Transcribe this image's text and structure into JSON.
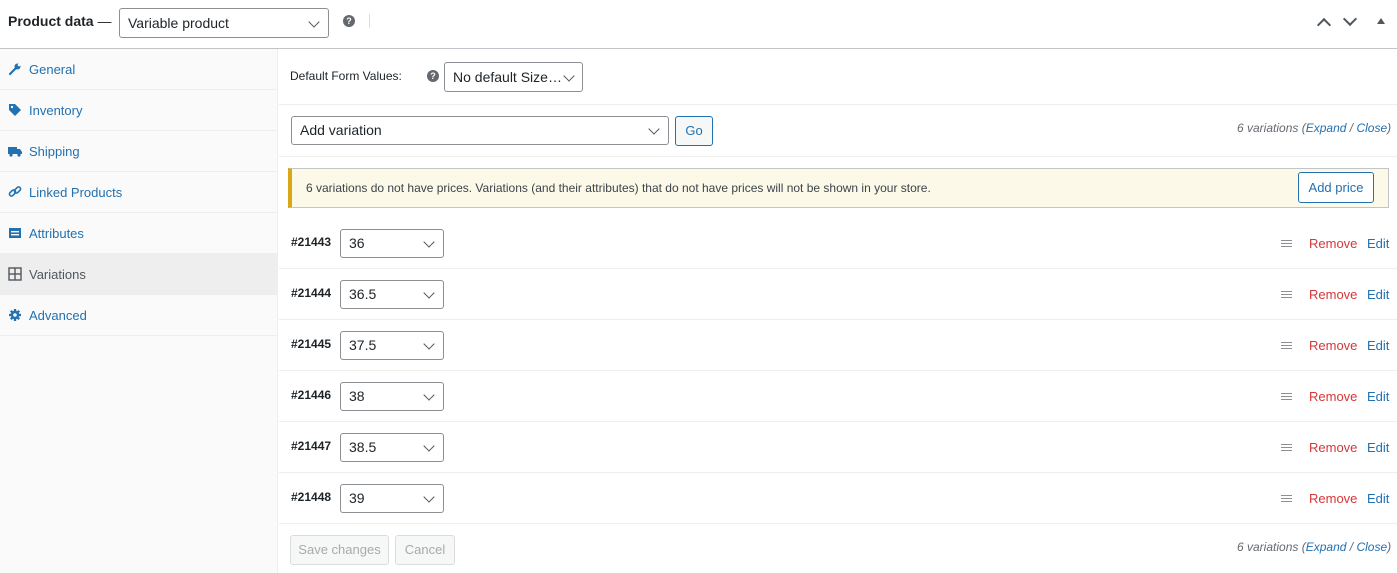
{
  "header": {
    "title": "Product data",
    "dash": "—",
    "product_type": "Variable product"
  },
  "sidebar": {
    "items": [
      {
        "label": "General",
        "icon": "wrench-icon"
      },
      {
        "label": "Inventory",
        "icon": "tag-icon"
      },
      {
        "label": "Shipping",
        "icon": "truck-icon"
      },
      {
        "label": "Linked Products",
        "icon": "link-icon"
      },
      {
        "label": "Attributes",
        "icon": "list-icon"
      },
      {
        "label": "Variations",
        "icon": "grid-icon",
        "active": true
      },
      {
        "label": "Advanced",
        "icon": "gear-icon"
      }
    ]
  },
  "defaults": {
    "label": "Default Form Values:",
    "value": "No default Size…"
  },
  "toolbar": {
    "action": "Add variation",
    "go": "Go",
    "count": "6 variations",
    "open_paren": "(",
    "expand": "Expand",
    "slash": " / ",
    "close": "Close",
    "close_paren": ")"
  },
  "notice": {
    "text": "6 variations do not have prices. Variations (and their attributes) that do not have prices will not be shown in your store.",
    "button": "Add price"
  },
  "variations": [
    {
      "id": "#21443",
      "size": "36"
    },
    {
      "id": "#21444",
      "size": "36.5"
    },
    {
      "id": "#21445",
      "size": "37.5"
    },
    {
      "id": "#21446",
      "size": "38"
    },
    {
      "id": "#21447",
      "size": "38.5"
    },
    {
      "id": "#21448",
      "size": "39"
    }
  ],
  "row_actions": {
    "remove": "Remove",
    "edit": "Edit"
  },
  "footer": {
    "save": "Save changes",
    "cancel": "Cancel"
  },
  "colors": {
    "link": "#2271b1",
    "danger": "#d63638",
    "notice_border": "#dba617",
    "notice_bg": "#fcf9e8"
  }
}
